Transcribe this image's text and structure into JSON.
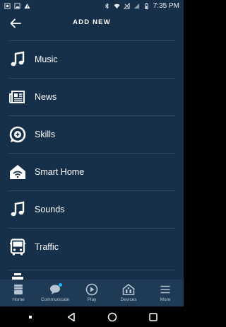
{
  "status_bar": {
    "time": "7:35 PM",
    "left_icons": [
      "notification-icon",
      "image-icon",
      "warning-icon"
    ],
    "right_icons": [
      "bluetooth-icon",
      "wifi-icon",
      "no-signal-icon",
      "signal-icon",
      "battery-icon"
    ]
  },
  "header": {
    "title": "ADD NEW",
    "back_icon": "arrow-left-icon"
  },
  "list": {
    "items": [
      {
        "label": "Music",
        "icon": "music-note-icon"
      },
      {
        "label": "News",
        "icon": "newspaper-icon"
      },
      {
        "label": "Skills",
        "icon": "skills-icon"
      },
      {
        "label": "Smart Home",
        "icon": "smart-home-icon"
      },
      {
        "label": "Sounds",
        "icon": "music-note-icon"
      },
      {
        "label": "Traffic",
        "icon": "bus-icon"
      }
    ]
  },
  "bottom_nav": {
    "items": [
      {
        "label": "Home",
        "icon": "home-icon"
      },
      {
        "label": "Communicate",
        "icon": "chat-icon"
      },
      {
        "label": "Play",
        "icon": "play-icon"
      },
      {
        "label": "Devices",
        "icon": "devices-icon"
      },
      {
        "label": "More",
        "icon": "menu-icon"
      }
    ]
  },
  "colors": {
    "background": "#173049",
    "divider": "#2e4a66",
    "nav_background": "#1f3a55",
    "accent": "#1fb6ff"
  }
}
